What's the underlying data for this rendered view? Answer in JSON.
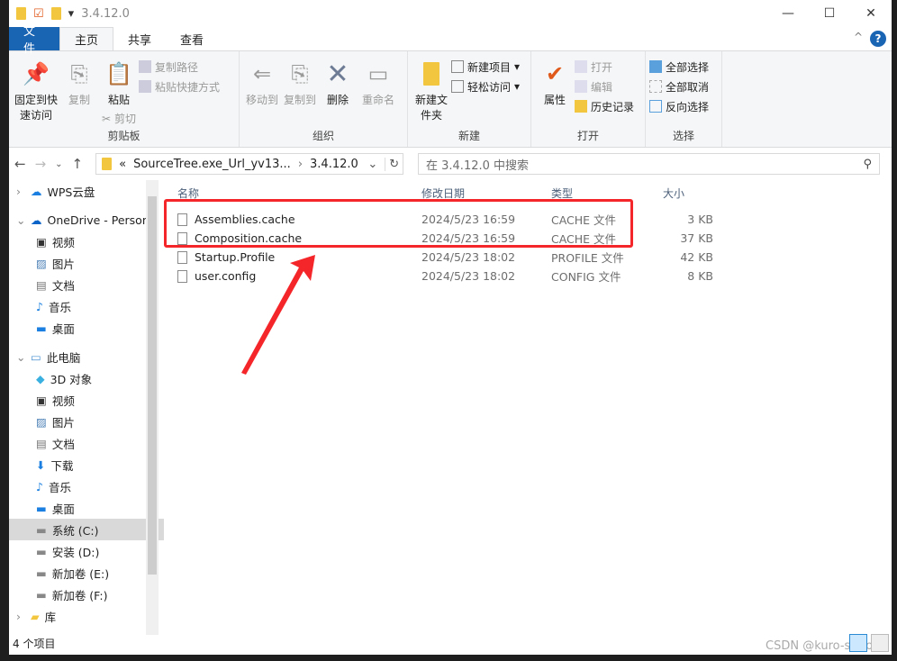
{
  "window": {
    "title": "3.4.12.0",
    "minimize": "—",
    "maximize": "☐",
    "close": "✕"
  },
  "tabs": [
    {
      "label": "文件"
    },
    {
      "label": "主页"
    },
    {
      "label": "共享"
    },
    {
      "label": "查看"
    }
  ],
  "help": "?",
  "ribbon": {
    "clipboard": {
      "label": "剪贴板",
      "pin": "固定到快速访问",
      "copy": "复制",
      "paste": "粘贴",
      "copy_path": "复制路径",
      "paste_shortcut": "粘贴快捷方式",
      "cut": "剪切"
    },
    "organize": {
      "label": "组织",
      "move_to": "移动到",
      "copy_to": "复制到",
      "delete": "删除",
      "rename": "重命名"
    },
    "new": {
      "label": "新建",
      "new_folder": "新建文件夹",
      "new_item": "新建项目",
      "easy_access": "轻松访问"
    },
    "open": {
      "label": "打开",
      "properties": "属性",
      "open": "打开",
      "edit": "编辑",
      "history": "历史记录"
    },
    "select": {
      "label": "选择",
      "select_all": "全部选择",
      "select_none": "全部取消",
      "invert": "反向选择"
    }
  },
  "address": {
    "prefix": "«",
    "crumb1": "SourceTree.exe_Url_yv13...",
    "sep": "›",
    "crumb2": "3.4.12.0",
    "search_placeholder": "在 3.4.12.0 中搜索"
  },
  "sidebar": [
    {
      "label": "WPS云盘",
      "icon": "cloud-icon"
    },
    {
      "label": "OneDrive - Persona",
      "icon": "onedrive-icon"
    },
    {
      "label": "视频",
      "icon": "video-icon"
    },
    {
      "label": "图片",
      "icon": "picture-icon"
    },
    {
      "label": "文档",
      "icon": "document-icon"
    },
    {
      "label": "音乐",
      "icon": "music-icon"
    },
    {
      "label": "桌面",
      "icon": "desktop-icon"
    },
    {
      "label": "此电脑",
      "icon": "computer-icon"
    },
    {
      "label": "3D 对象",
      "icon": "3d-icon"
    },
    {
      "label": "视频",
      "icon": "video-icon"
    },
    {
      "label": "图片",
      "icon": "picture-icon"
    },
    {
      "label": "文档",
      "icon": "document-icon"
    },
    {
      "label": "下载",
      "icon": "download-icon"
    },
    {
      "label": "音乐",
      "icon": "music-icon"
    },
    {
      "label": "桌面",
      "icon": "desktop-icon"
    },
    {
      "label": "系统 (C:)",
      "icon": "drive-icon"
    },
    {
      "label": "安装 (D:)",
      "icon": "drive-icon"
    },
    {
      "label": "新加卷 (E:)",
      "icon": "drive-icon"
    },
    {
      "label": "新加卷 (F:)",
      "icon": "drive-icon"
    },
    {
      "label": "库",
      "icon": "library-icon"
    }
  ],
  "columns": {
    "name": "名称",
    "date": "修改日期",
    "type": "类型",
    "size": "大小"
  },
  "files": [
    {
      "name": "Assemblies.cache",
      "date": "2024/5/23 16:59",
      "type": "CACHE 文件",
      "size": "3 KB"
    },
    {
      "name": "Composition.cache",
      "date": "2024/5/23 16:59",
      "type": "CACHE 文件",
      "size": "37 KB"
    },
    {
      "name": "Startup.Profile",
      "date": "2024/5/23 18:02",
      "type": "PROFILE 文件",
      "size": "42 KB"
    },
    {
      "name": "user.config",
      "date": "2024/5/23 18:02",
      "type": "CONFIG 文件",
      "size": "8 KB"
    }
  ],
  "status": "4 个项目",
  "watermark": "CSDN @kuro-shiro",
  "colors": {
    "accent": "#1a64b4",
    "highlight": "#f5262a"
  }
}
